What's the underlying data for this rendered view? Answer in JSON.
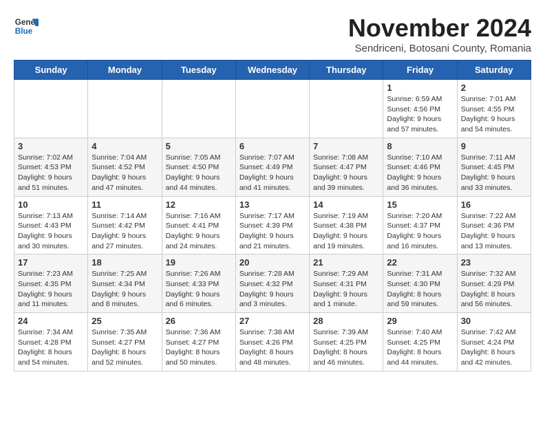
{
  "logo": {
    "line1": "General",
    "line2": "Blue"
  },
  "title": "November 2024",
  "subtitle": "Sendriceni, Botosani County, Romania",
  "days_of_week": [
    "Sunday",
    "Monday",
    "Tuesday",
    "Wednesday",
    "Thursday",
    "Friday",
    "Saturday"
  ],
  "weeks": [
    [
      {
        "day": "",
        "info": ""
      },
      {
        "day": "",
        "info": ""
      },
      {
        "day": "",
        "info": ""
      },
      {
        "day": "",
        "info": ""
      },
      {
        "day": "",
        "info": ""
      },
      {
        "day": "1",
        "info": "Sunrise: 6:59 AM\nSunset: 4:56 PM\nDaylight: 9 hours and 57 minutes."
      },
      {
        "day": "2",
        "info": "Sunrise: 7:01 AM\nSunset: 4:55 PM\nDaylight: 9 hours and 54 minutes."
      }
    ],
    [
      {
        "day": "3",
        "info": "Sunrise: 7:02 AM\nSunset: 4:53 PM\nDaylight: 9 hours and 51 minutes."
      },
      {
        "day": "4",
        "info": "Sunrise: 7:04 AM\nSunset: 4:52 PM\nDaylight: 9 hours and 47 minutes."
      },
      {
        "day": "5",
        "info": "Sunrise: 7:05 AM\nSunset: 4:50 PM\nDaylight: 9 hours and 44 minutes."
      },
      {
        "day": "6",
        "info": "Sunrise: 7:07 AM\nSunset: 4:49 PM\nDaylight: 9 hours and 41 minutes."
      },
      {
        "day": "7",
        "info": "Sunrise: 7:08 AM\nSunset: 4:47 PM\nDaylight: 9 hours and 39 minutes."
      },
      {
        "day": "8",
        "info": "Sunrise: 7:10 AM\nSunset: 4:46 PM\nDaylight: 9 hours and 36 minutes."
      },
      {
        "day": "9",
        "info": "Sunrise: 7:11 AM\nSunset: 4:45 PM\nDaylight: 9 hours and 33 minutes."
      }
    ],
    [
      {
        "day": "10",
        "info": "Sunrise: 7:13 AM\nSunset: 4:43 PM\nDaylight: 9 hours and 30 minutes."
      },
      {
        "day": "11",
        "info": "Sunrise: 7:14 AM\nSunset: 4:42 PM\nDaylight: 9 hours and 27 minutes."
      },
      {
        "day": "12",
        "info": "Sunrise: 7:16 AM\nSunset: 4:41 PM\nDaylight: 9 hours and 24 minutes."
      },
      {
        "day": "13",
        "info": "Sunrise: 7:17 AM\nSunset: 4:39 PM\nDaylight: 9 hours and 21 minutes."
      },
      {
        "day": "14",
        "info": "Sunrise: 7:19 AM\nSunset: 4:38 PM\nDaylight: 9 hours and 19 minutes."
      },
      {
        "day": "15",
        "info": "Sunrise: 7:20 AM\nSunset: 4:37 PM\nDaylight: 9 hours and 16 minutes."
      },
      {
        "day": "16",
        "info": "Sunrise: 7:22 AM\nSunset: 4:36 PM\nDaylight: 9 hours and 13 minutes."
      }
    ],
    [
      {
        "day": "17",
        "info": "Sunrise: 7:23 AM\nSunset: 4:35 PM\nDaylight: 9 hours and 11 minutes."
      },
      {
        "day": "18",
        "info": "Sunrise: 7:25 AM\nSunset: 4:34 PM\nDaylight: 9 hours and 8 minutes."
      },
      {
        "day": "19",
        "info": "Sunrise: 7:26 AM\nSunset: 4:33 PM\nDaylight: 9 hours and 6 minutes."
      },
      {
        "day": "20",
        "info": "Sunrise: 7:28 AM\nSunset: 4:32 PM\nDaylight: 9 hours and 3 minutes."
      },
      {
        "day": "21",
        "info": "Sunrise: 7:29 AM\nSunset: 4:31 PM\nDaylight: 9 hours and 1 minute."
      },
      {
        "day": "22",
        "info": "Sunrise: 7:31 AM\nSunset: 4:30 PM\nDaylight: 8 hours and 59 minutes."
      },
      {
        "day": "23",
        "info": "Sunrise: 7:32 AM\nSunset: 4:29 PM\nDaylight: 8 hours and 56 minutes."
      }
    ],
    [
      {
        "day": "24",
        "info": "Sunrise: 7:34 AM\nSunset: 4:28 PM\nDaylight: 8 hours and 54 minutes."
      },
      {
        "day": "25",
        "info": "Sunrise: 7:35 AM\nSunset: 4:27 PM\nDaylight: 8 hours and 52 minutes."
      },
      {
        "day": "26",
        "info": "Sunrise: 7:36 AM\nSunset: 4:27 PM\nDaylight: 8 hours and 50 minutes."
      },
      {
        "day": "27",
        "info": "Sunrise: 7:38 AM\nSunset: 4:26 PM\nDaylight: 8 hours and 48 minutes."
      },
      {
        "day": "28",
        "info": "Sunrise: 7:39 AM\nSunset: 4:25 PM\nDaylight: 8 hours and 46 minutes."
      },
      {
        "day": "29",
        "info": "Sunrise: 7:40 AM\nSunset: 4:25 PM\nDaylight: 8 hours and 44 minutes."
      },
      {
        "day": "30",
        "info": "Sunrise: 7:42 AM\nSunset: 4:24 PM\nDaylight: 8 hours and 42 minutes."
      }
    ]
  ]
}
